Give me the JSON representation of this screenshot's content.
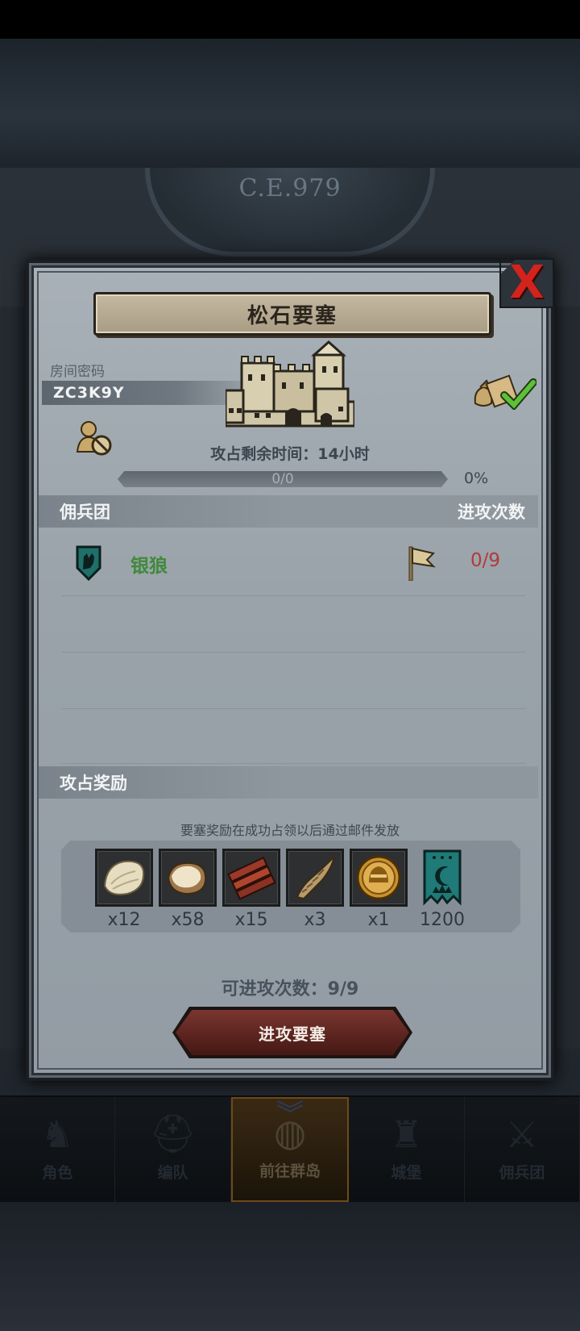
{
  "background": {
    "era_label": "C.E.979"
  },
  "bottom_nav": {
    "items": [
      {
        "label": "角色",
        "icon": "knight-icon"
      },
      {
        "label": "编队",
        "icon": "helmet-icon"
      },
      {
        "label": "前往群岛",
        "icon": "globe-icon",
        "active": true
      },
      {
        "label": "城堡",
        "icon": "castle-icon"
      },
      {
        "label": "佣兵团",
        "icon": "mercenary-icon"
      }
    ]
  },
  "modal": {
    "title": "松石要塞",
    "close_glyph": "X",
    "room": {
      "label": "房间密码",
      "code": "ZC3K9Y"
    },
    "timer": {
      "label": "攻占剩余时间：",
      "value": "14小时"
    },
    "progress": {
      "text": "0/0",
      "percent_label": "0%",
      "fraction": 0
    },
    "mercenary_section": {
      "title": "佣兵团",
      "right_title": "进攻次数",
      "rows": [
        {
          "name": "银狼",
          "count": "0/9",
          "emblem_icon": "wolf-shield-icon",
          "flag_icon": "flag-icon"
        }
      ]
    },
    "reward_section": {
      "title": "攻占奖励",
      "note": "要塞奖励在成功占领以后通过邮件发放",
      "items": [
        {
          "icon": "fur-pelt-icon",
          "qty": "x12"
        },
        {
          "icon": "leather-hide-icon",
          "qty": "x58"
        },
        {
          "icon": "wood-planks-icon",
          "qty": "x15"
        },
        {
          "icon": "horn-icon",
          "qty": "x3"
        },
        {
          "icon": "gold-helmet-coin-icon",
          "qty": "x1"
        },
        {
          "icon": "moon-banner-icon",
          "qty": "1200"
        }
      ]
    },
    "attack_count": {
      "label": "可进攻次数：",
      "value": "9/9"
    },
    "attack_button": "进攻要塞"
  },
  "colors": {
    "accent_red": "#d2231c",
    "merc_green": "#3f8a3a",
    "count_red": "#b23a3a",
    "button_red": "#5a231e",
    "panel_gray": "#a9b1b8"
  }
}
